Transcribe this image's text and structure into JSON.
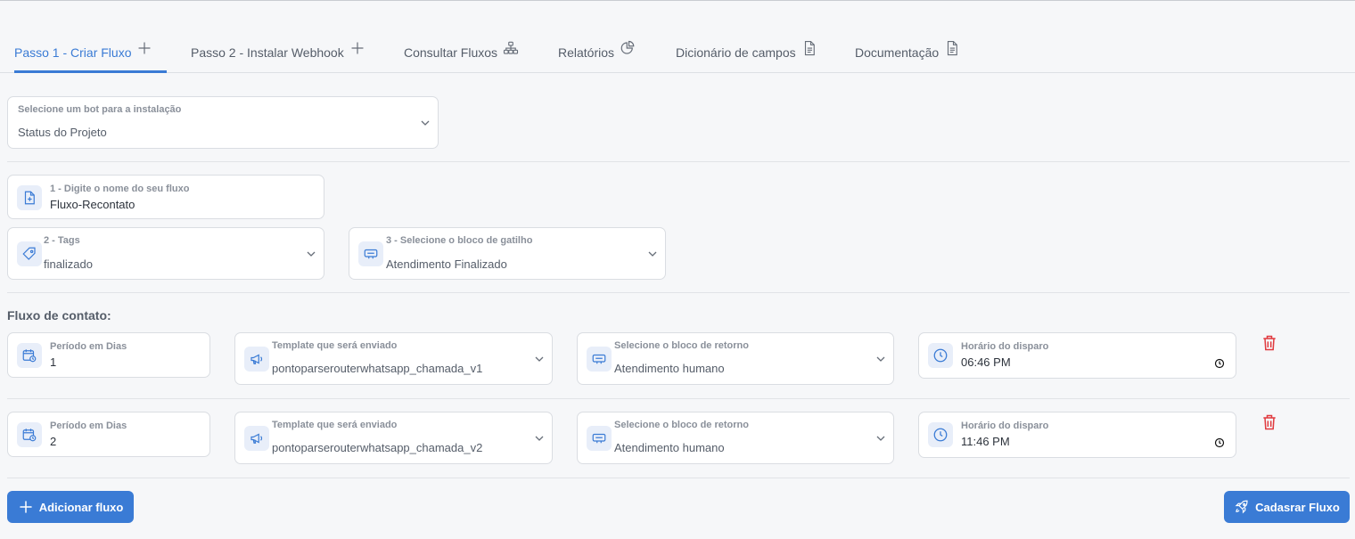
{
  "tabs": [
    {
      "label": "Passo 1 - Criar Fluxo",
      "icon": "plus-icon",
      "active": true
    },
    {
      "label": "Passo 2 - Instalar Webhook",
      "icon": "plus-icon"
    },
    {
      "label": "Consultar Fluxos",
      "icon": "sitemap-icon"
    },
    {
      "label": "Relatórios",
      "icon": "pie-chart-icon"
    },
    {
      "label": "Dicionário de campos",
      "icon": "document-icon"
    },
    {
      "label": "Documentação",
      "icon": "document-icon"
    }
  ],
  "bot_select": {
    "label": "Selecione um bot para a instalação",
    "value": "Status do Projeto"
  },
  "flow_name": {
    "label": "1 - Digite o nome do seu fluxo",
    "value": "Fluxo-Recontato"
  },
  "tags": {
    "label": "2 - Tags",
    "value": "finalizado"
  },
  "trigger_block": {
    "label": "3 - Selecione o bloco de gatilho",
    "value": "Atendimento Finalizado"
  },
  "contact_flow": {
    "title": "Fluxo de contato:",
    "rows": [
      {
        "period_label": "Período em Dias",
        "period_value": "1",
        "template_label": "Template que será enviado",
        "template_value": "pontoparserouterwhatsapp_chamada_v1",
        "return_label": "Selecione o bloco de retorno",
        "return_value": "Atendimento humano",
        "time_label": "Horário do disparo",
        "time_value": "06:46 PM"
      },
      {
        "period_label": "Período em Dias",
        "period_value": "2",
        "template_label": "Template que será enviado",
        "template_value": "pontoparserouterwhatsapp_chamada_v2",
        "return_label": "Selecione o bloco de retorno",
        "return_value": "Atendimento humano",
        "time_label": "Horário do disparo",
        "time_value": "11:46 PM"
      }
    ]
  },
  "buttons": {
    "add_flow": "Adicionar fluxo",
    "register_flow": "Cadasrar Fluxo"
  },
  "colors": {
    "accent": "#3a7bd5",
    "danger": "#e0393e",
    "icon_bg": "#e8eef9"
  }
}
